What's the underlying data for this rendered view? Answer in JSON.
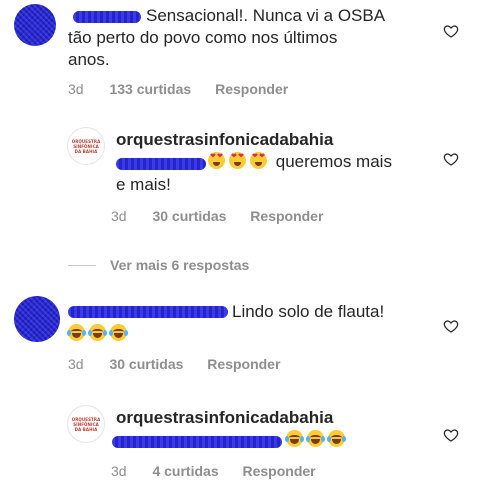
{
  "comments": [
    {
      "text": "Sensacional!. Nunca vi a OSBA",
      "text_line2": "tão perto do povo como nos últimos",
      "text_line3": "anos.",
      "time": "3d",
      "likes": "133 curtidas",
      "reply_label": "Responder",
      "replies": [
        {
          "username": "orquestrasinfonicadabahia",
          "text": "queremos mais",
          "text_line2": "e mais!",
          "emojis": [
            "heart-eyes",
            "heart-eyes",
            "heart-eyes"
          ],
          "time": "3d",
          "likes": "30 curtidas",
          "reply_label": "Responder"
        }
      ],
      "view_more_label": "Ver mais 6 respostas"
    },
    {
      "text": "Lindo solo de flauta!",
      "emojis": [
        "tears-of-joy",
        "tears-of-joy",
        "tears-of-joy"
      ],
      "time": "3d",
      "likes": "30 curtidas",
      "reply_label": "Responder",
      "replies": [
        {
          "username": "orquestrasinfonicadabahia",
          "emojis": [
            "tears-of-joy",
            "tears-of-joy",
            "tears-of-joy"
          ],
          "time": "3d",
          "likes": "4 curtidas",
          "reply_label": "Responder"
        }
      ]
    }
  ],
  "logo": {
    "line1": "ORQUESTRA",
    "line2": "SINFÔNICA",
    "line3": "DA BAHIA"
  },
  "colors": {
    "text": "#262626",
    "meta": "#8e8e8e",
    "redaction": "#2f2fd6",
    "logo_red": "#c0392b"
  }
}
